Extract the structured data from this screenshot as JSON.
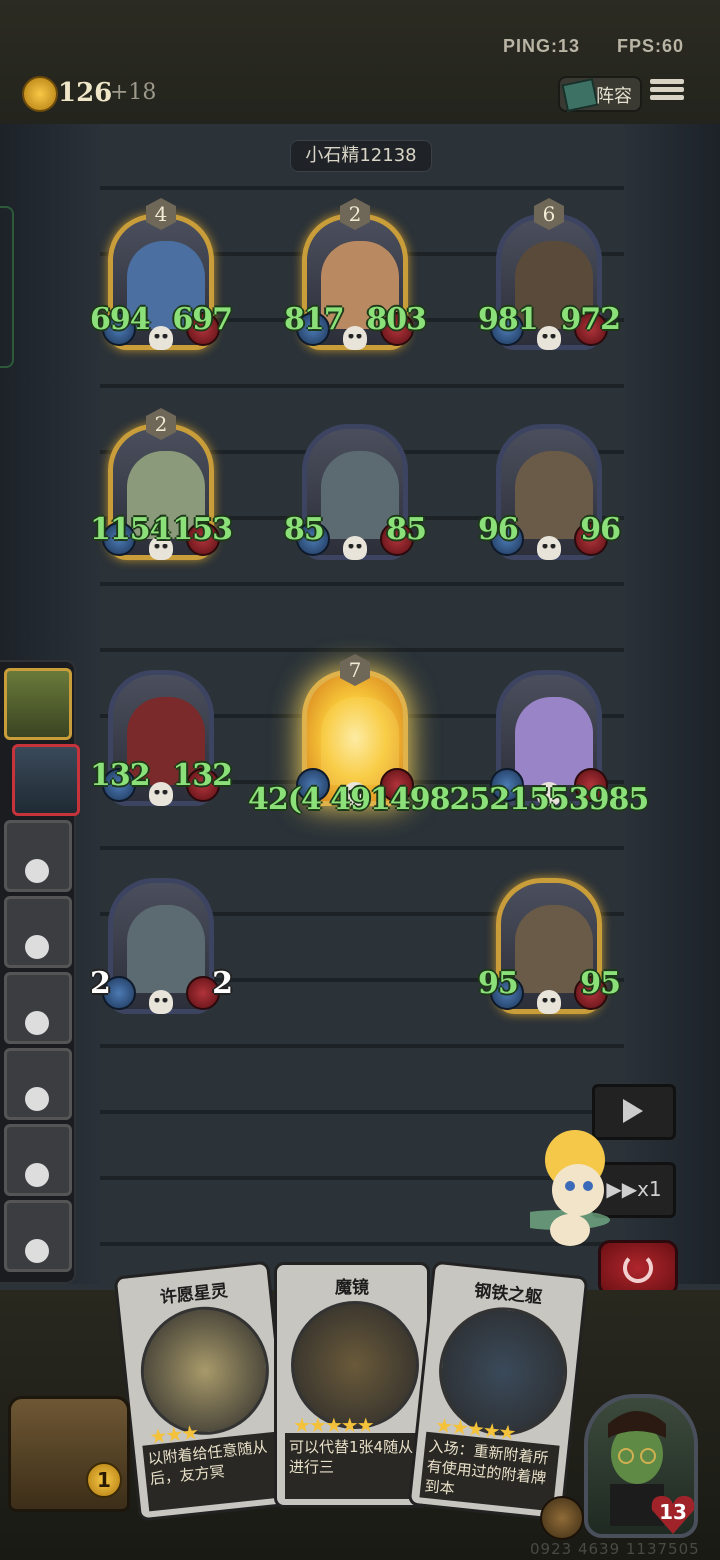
{
  "top_bar": {
    "ping": "PING:13",
    "fps": "FPS:60",
    "coins": "126",
    "coins_income": "+18",
    "lineup_label": "阵容"
  },
  "opponent": {
    "name": "小石精12138"
  },
  "board": {
    "minions": [
      {
        "tier": "4",
        "atk": "694",
        "hp": "697",
        "golden": true,
        "art_color": "#4a6fa0"
      },
      {
        "tier": "2",
        "atk": "817",
        "hp": "803",
        "golden": true,
        "art_color": "#b98a62"
      },
      {
        "tier": "6",
        "atk": "981",
        "hp": "972",
        "golden": false,
        "art_color": "#5a4a3a"
      },
      {
        "tier": "2",
        "atk": "1154",
        "hp": "1153",
        "golden": true,
        "art_color": "#8a9a7a"
      },
      {
        "tier": "",
        "atk": "85",
        "hp": "85",
        "golden": false,
        "art_color": "#5c6a72"
      },
      {
        "tier": "",
        "atk": "96",
        "hp": "96",
        "golden": false,
        "art_color": "#6a5a48"
      },
      {
        "tier": "",
        "atk": "132",
        "hp": "132",
        "golden": false,
        "art_color": "#7a2a2a"
      },
      {
        "tier": "7",
        "atk": "",
        "hp": "",
        "golden": true,
        "art_color": "#f8d860"
      },
      {
        "tier": "",
        "atk": "",
        "hp": "",
        "golden": false,
        "art_color": "#9a84c8"
      },
      {
        "tier": "",
        "atk": "2",
        "hp": "2",
        "golden": false,
        "art_color": "#5c6a72"
      },
      {
        "tier": "",
        "atk": "95",
        "hp": "95",
        "golden": true,
        "art_color": "#6a5a48"
      }
    ],
    "overflow_numbers": "42(4 4914982521553985"
  },
  "hand_cards": [
    {
      "name": "许愿星灵",
      "text": "以附着给任意随从后，友方冥",
      "keyword": "附着",
      "stars": "★★★"
    },
    {
      "name": "魔镜",
      "text": "可以代替1张4随从进行三",
      "keyword": "",
      "stars": "★★★★★"
    },
    {
      "name": "钢铁之躯",
      "text": "入场：重新附着所有使用过的附着牌到本",
      "keyword": "入场：",
      "stars": "★★★★★"
    }
  ],
  "controls": {
    "speed_label": "▶▶x1"
  },
  "player": {
    "chest_count": "1",
    "health": "13"
  },
  "footer": {
    "match_id": "0923 4639 1137505"
  }
}
